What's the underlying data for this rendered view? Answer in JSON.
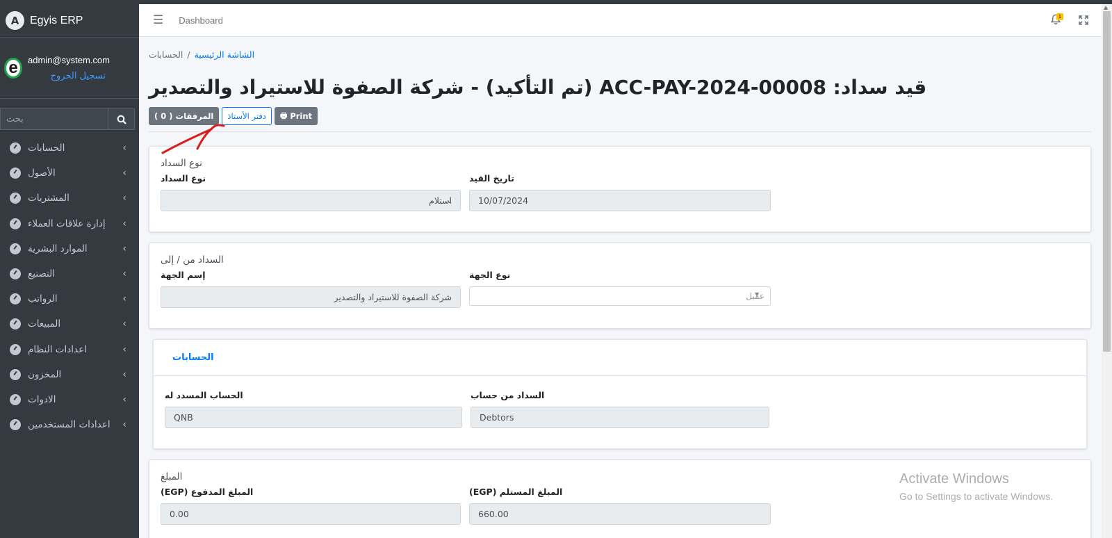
{
  "app": {
    "name": "Egyis ERP"
  },
  "user": {
    "email": "admin@system.com",
    "logout": "تسجيل الخروج",
    "avatar_letter": "e"
  },
  "search": {
    "placeholder": "بحث"
  },
  "sidebar": {
    "items": [
      {
        "label": "الحسابات"
      },
      {
        "label": "الأصول"
      },
      {
        "label": "المشتريات"
      },
      {
        "label": "إدارة علاقات العملاء"
      },
      {
        "label": "الموارد البشرية"
      },
      {
        "label": "التصنيع"
      },
      {
        "label": "الرواتب"
      },
      {
        "label": "المبيعات"
      },
      {
        "label": "اعدادات النظام"
      },
      {
        "label": "المخزون"
      },
      {
        "label": "الادوات"
      },
      {
        "label": "اعدادات المستخدمين"
      }
    ]
  },
  "topnav": {
    "dashboard": "Dashboard",
    "notification_count": "1"
  },
  "breadcrumb": {
    "home": "الشاشة الرئيسية",
    "separator": "/",
    "current": "الحسابات"
  },
  "page": {
    "title": "قيد سداد: ACC-PAY-2024-00008 (تم التأكيد) - شركة الصفوة للاستيراد والتصدير",
    "buttons": {
      "attachments": "المرفقات ( 0 )",
      "ledger": "دفتر الأستاذ",
      "print": "Print"
    }
  },
  "payment_type_section": {
    "legend": "نوع السداد",
    "payment_type_label": "نوع السداد",
    "payment_type_value": "استلام",
    "date_label": "تاريخ القيد",
    "date_value": "10/07/2024"
  },
  "party_section": {
    "legend": "السداد من / إلى",
    "party_name_label": "إسم الجهة",
    "party_name_value": "شركة الصفوة للاستيراد والتصدير",
    "party_type_label": "نوع الجهة",
    "party_type_value": "عميل"
  },
  "accounts_section": {
    "tab": "الحسابات",
    "paid_to_label": "الحساب المسدد له",
    "paid_to_value": "QNB",
    "paid_from_label": "السداد من حساب",
    "paid_from_value": "Debtors"
  },
  "amount_section": {
    "legend": "المبلغ",
    "paid_label": "المبلغ المدفوع (EGP)",
    "paid_value": "0.00",
    "received_label": "المبلغ المستلم (EGP)",
    "received_value": "660.00"
  },
  "watermark": {
    "line1": "Activate Windows",
    "line2": "Go to Settings to activate Windows."
  },
  "colors": {
    "sidebar": "#343a40",
    "accent": "#007bff",
    "annotation": "#d81b1b"
  }
}
